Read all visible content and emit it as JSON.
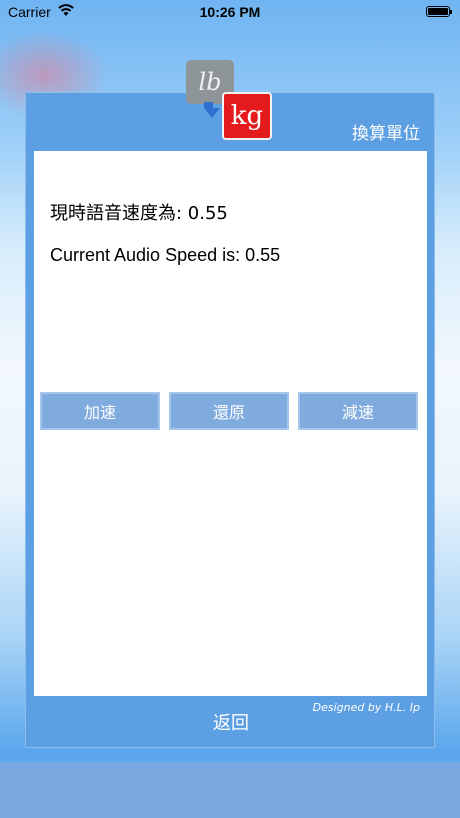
{
  "status_bar": {
    "carrier": "Carrier",
    "time": "10:26 PM"
  },
  "logo": {
    "from_unit": "lb",
    "to_unit": "kg"
  },
  "header": {
    "convert_label": "換算單位"
  },
  "speed": {
    "zh_text": "現時語音速度為: 0.55",
    "en_text": "Current Audio Speed is: 0.55"
  },
  "controls": {
    "speed_up": "加速",
    "reset": "還原",
    "slow_down": "減速"
  },
  "footer": {
    "back_label": "返回",
    "credit": "Designed by H.L. Ip"
  }
}
